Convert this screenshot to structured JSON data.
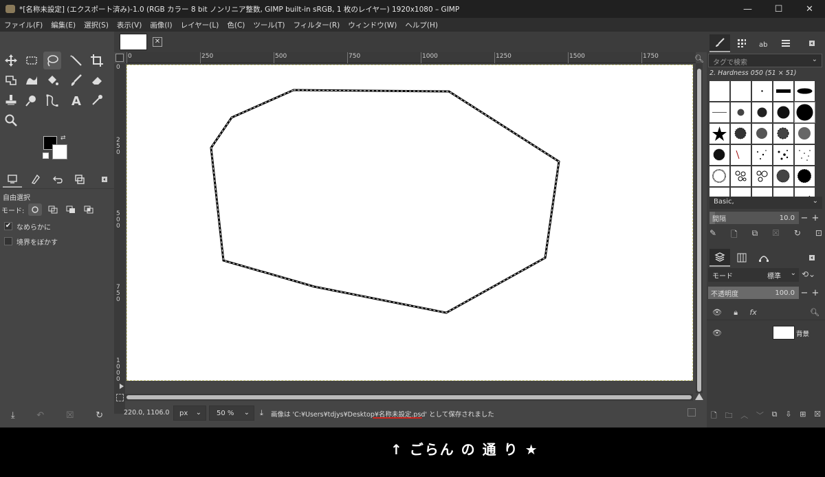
{
  "window": {
    "title": "*[名称未設定] (エクスポート済み)-1.0 (RGB カラー 8 bit ノンリニア整数, GIMP built-in sRGB, 1 枚のレイヤー) 1920x1080 – GIMP",
    "minimize": "—",
    "maximize": "☐",
    "close": "✕"
  },
  "menu": [
    "ファイル(F)",
    "編集(E)",
    "選択(S)",
    "表示(V)",
    "画像(I)",
    "レイヤー(L)",
    "色(C)",
    "ツール(T)",
    "フィルター(R)",
    "ウィンドウ(W)",
    "ヘルプ(H)"
  ],
  "tool_options": {
    "title": "自由選択",
    "mode_label": "モード:",
    "antialias_label": "なめらかに",
    "antialias_checked": true,
    "feather_label": "境界をぼかす",
    "feather_checked": false
  },
  "ruler": {
    "h": [
      "0",
      "250",
      "500",
      "750",
      "1000",
      "1250",
      "1500",
      "1750"
    ],
    "v": [
      "0",
      "250",
      "500",
      "750",
      "1000"
    ]
  },
  "status": {
    "coords": "220.0, 1106.0",
    "unit": "px",
    "zoom": "50 %",
    "message": "画像は 'C:¥Users¥tdjys¥Desktop¥名称未設定.psd' として保存されました"
  },
  "brushes": {
    "tag_placeholder": "タグで検索",
    "selected_name": "2. Hardness 050 (51 × 51)",
    "preset": "Basic,",
    "spacing_label": "間隔",
    "spacing_value": "10.0"
  },
  "layers": {
    "mode_label": "モード",
    "mode_value": "標準",
    "opacity_label": "不透明度",
    "opacity_value": "100.0",
    "layer_name": "背景"
  },
  "caption": "↑ ごらん の 通 り ★",
  "colors": {
    "accent_underline": "#d0261f",
    "foreground": "#000000",
    "background": "#ffffff"
  }
}
